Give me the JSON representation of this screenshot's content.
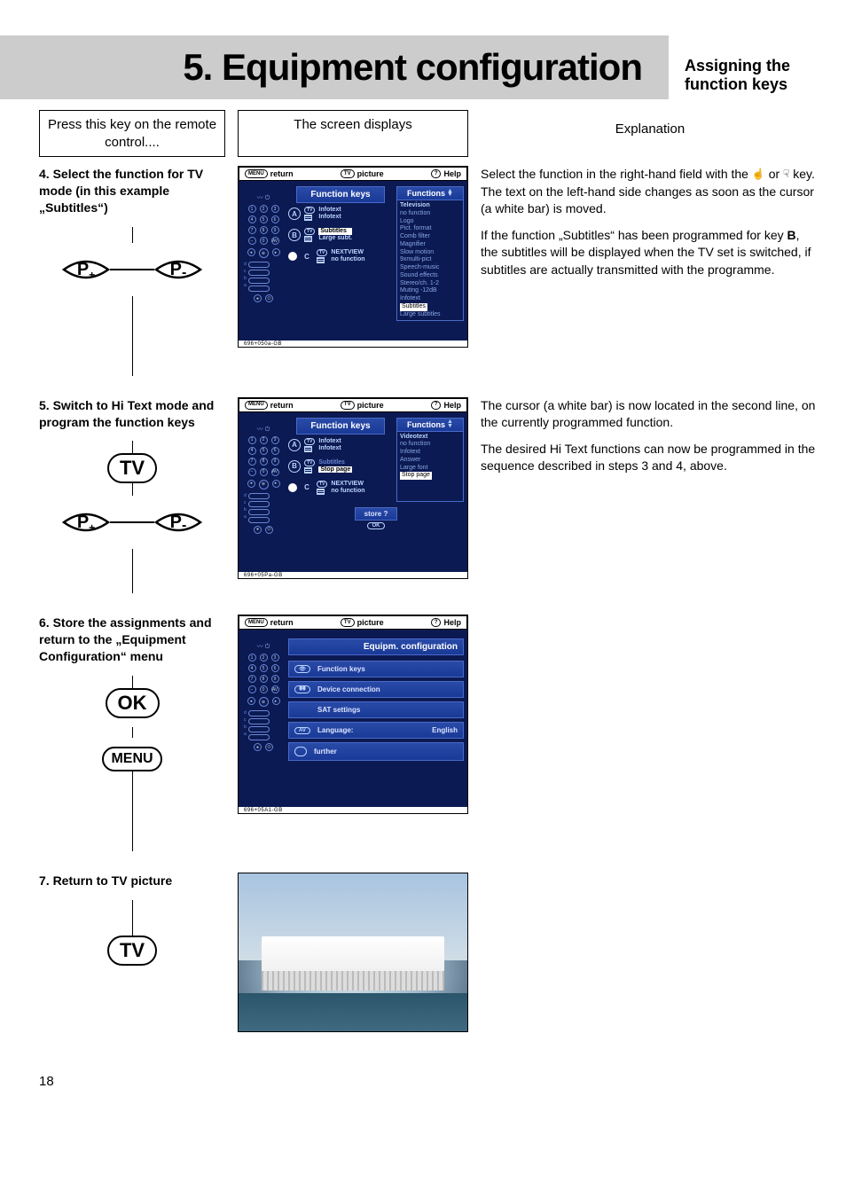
{
  "banner": {
    "chapter": "5. Equipment configuration",
    "sub1": "Assigning the",
    "sub2": "function keys"
  },
  "headers": {
    "left": "Press this key on the remote control....",
    "mid": "The screen displays",
    "right": "Explanation"
  },
  "keys": {
    "Pplus": "P",
    "Pminus": "P",
    "plus": "+",
    "minus": "-",
    "TV": "TV",
    "OK": "OK",
    "MENU": "MENU"
  },
  "osd_top": {
    "return_icon": "MENU",
    "return": "return",
    "picture_icon": "TV",
    "picture": "picture",
    "help_icon": "?",
    "help": "Help"
  },
  "step4": {
    "title": "4. Select the function for TV mode (in this example „Subtitles“)",
    "explain1_a": "Select the function in the right-hand field with the ",
    "explain1_b": " or ",
    "explain1_c": " key. The text on the left-hand side changes as soon as the cursor (a white bar) is moved.",
    "explain2_a": "If the function „Subtitles“ has been programmed for key ",
    "explain2_bold": "B",
    "explain2_b": ", the subtitles will be displayed when the TV set is switched, if subtitles are actually transmitted with the programme.",
    "osd": {
      "title": "Function keys",
      "side_title": "Functions",
      "A1": "Infotext",
      "A2": "Infotext",
      "B1": "Subtitles",
      "B2": "Large subt.",
      "C1": "NEXTVIEW",
      "C2": "no function",
      "side_head": "Television",
      "side": [
        "no function",
        "Logo",
        "Pict. format",
        "Comb filter",
        "Magnifier",
        "Slow motion",
        "9xmulti-pict",
        "Speech-music",
        "Sound effects",
        "Stereo/ch. 1-2",
        "Muting -12dB",
        "Infotext",
        "Subtitles",
        "Large subtitles"
      ],
      "side_selected": "Subtitles",
      "ref": "696+050a-GB"
    }
  },
  "step5": {
    "title": "5. Switch to Hi Text mode and program the function keys",
    "explain1": "The cursor (a white bar) is now located in the second line, on the currently programmed function.",
    "explain2": "The desired Hi Text functions can now be programmed in the sequence described in steps 3 and 4, above.",
    "osd": {
      "title": "Function keys",
      "side_title": "Functions",
      "A1": "Infotext",
      "A2": "Infotext",
      "B1": "Subtitles",
      "B2": "Stop page",
      "C1": "NEXTVIEW",
      "C2": "no function",
      "side_head": "Videotext",
      "side": [
        "no function",
        "Infotext",
        "Answer",
        "Large font",
        "Stop page"
      ],
      "side_selected": "Stop page",
      "store": "store ?",
      "ok": "OK",
      "ref": "696+05Pa-GB"
    }
  },
  "step6": {
    "title": "6. Store the assignments and return to the „Equipment Configuration“ menu",
    "osd": {
      "title": "Equipm. configuration",
      "rows": {
        "r1": "Function keys",
        "r2": "Device connection",
        "r3": "SAT settings",
        "r4_label": "Language:",
        "r4_value": "English",
        "r5": "further"
      },
      "icons": {
        "eye": "👁",
        "plug": "⎋",
        "av": "AV"
      },
      "ref": "696+05A1-GB"
    }
  },
  "step7": {
    "title": "7. Return to TV picture"
  },
  "page_number": "18"
}
